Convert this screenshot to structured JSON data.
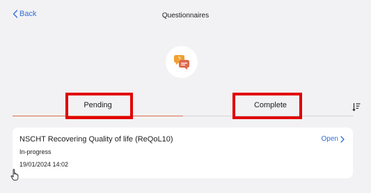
{
  "nav": {
    "back_label": "Back",
    "title": "Questionnaires"
  },
  "hero": {
    "icon": "chat-bubbles-icon",
    "accent_color": "#f0a030",
    "icon_color": "#e06a4e"
  },
  "tabs": [
    {
      "label": "Pending",
      "active": true
    },
    {
      "label": "Complete",
      "active": false
    }
  ],
  "colors": {
    "link": "#2f6fd8",
    "active_tab_underline": "#e06a4e",
    "highlight_box": "#e10000"
  },
  "questionnaires": [
    {
      "title": "NSCHT Recovering Quality of life (ReQoL10)",
      "status": "In-progress",
      "date": "19/01/2024 14:02",
      "action_label": "Open"
    }
  ]
}
